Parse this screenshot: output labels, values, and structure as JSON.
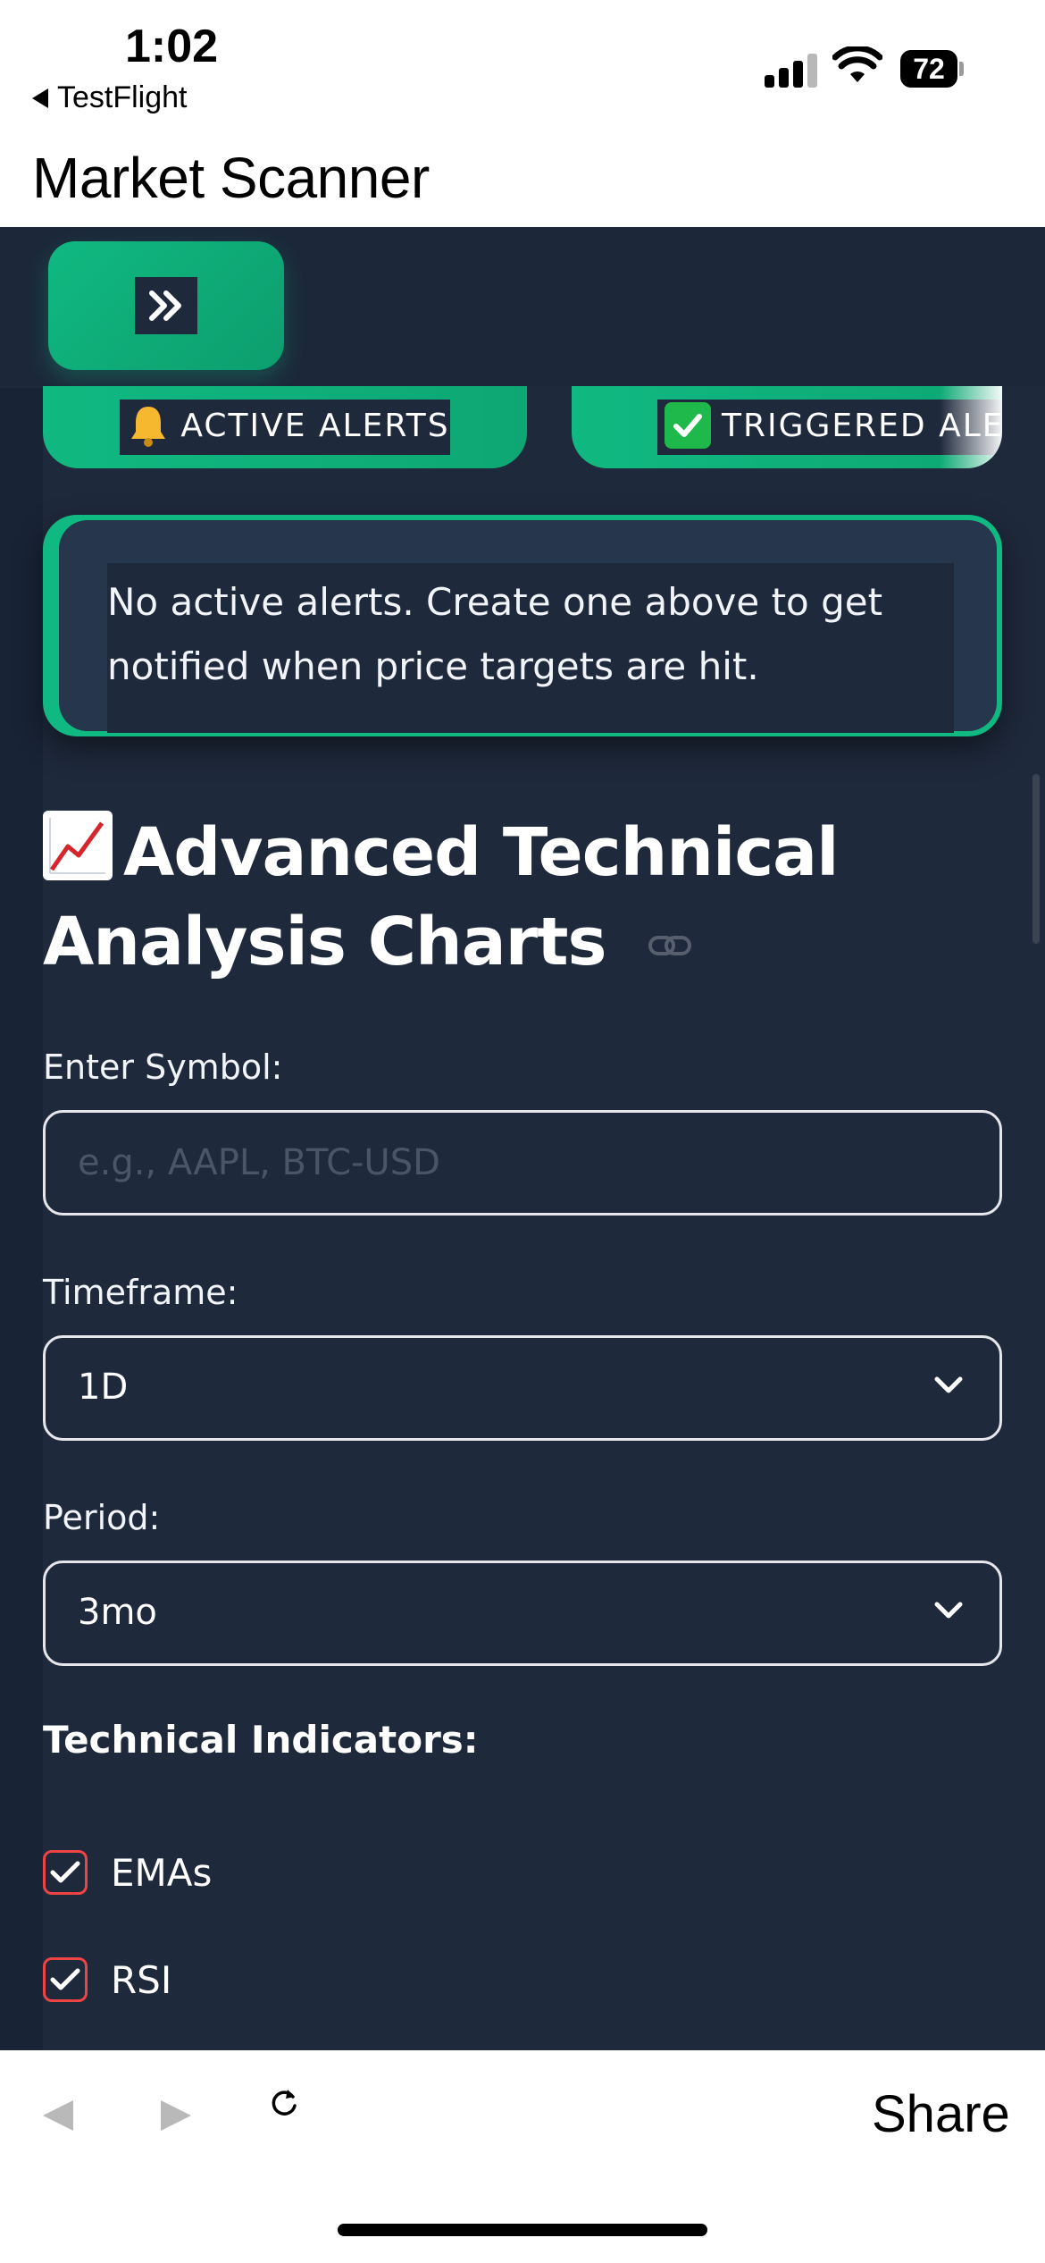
{
  "status_bar": {
    "time": "1:02",
    "back_app": "TestFlight",
    "battery": "72",
    "icons": [
      "cellular-signal-icon",
      "wifi-icon",
      "battery-icon"
    ]
  },
  "nav": {
    "title": "Market Scanner"
  },
  "header": {
    "toggle_icon": "double-chevron-right-icon",
    "accent_color": "#10b981"
  },
  "alert_tabs": [
    {
      "emoji": "bell-icon",
      "label": "ACTIVE ALERTS"
    },
    {
      "emoji": "check-mark-button-icon",
      "label": "TRIGGERED ALER"
    }
  ],
  "alerts_info": {
    "line1": "No active alerts. Create one above to get",
    "line2": "notified when price targets are hit."
  },
  "section": {
    "emoji": "chart-increasing-icon",
    "title_line1": "Advanced Technical",
    "title_line2": "Analysis Charts",
    "anchor_icon": "link-icon"
  },
  "form": {
    "symbol_label": "Enter Symbol:",
    "symbol_placeholder": "e.g., AAPL, BTC-USD",
    "symbol_value": "",
    "timeframe_label": "Timeframe:",
    "timeframe_value": "1D",
    "period_label": "Period:",
    "period_value": "3mo"
  },
  "indicators": {
    "heading": "Technical Indicators:",
    "items": [
      {
        "label": "EMAs",
        "checked": true
      },
      {
        "label": "RSI",
        "checked": true
      }
    ],
    "checkbox_color": "#ef4444"
  },
  "toolbar": {
    "share_label": "Share",
    "icons": [
      "back-arrow-icon",
      "forward-arrow-icon",
      "reload-icon"
    ]
  },
  "colors": {
    "background": "#1e293b",
    "accent": "#10b981",
    "text": "#ffffff"
  }
}
